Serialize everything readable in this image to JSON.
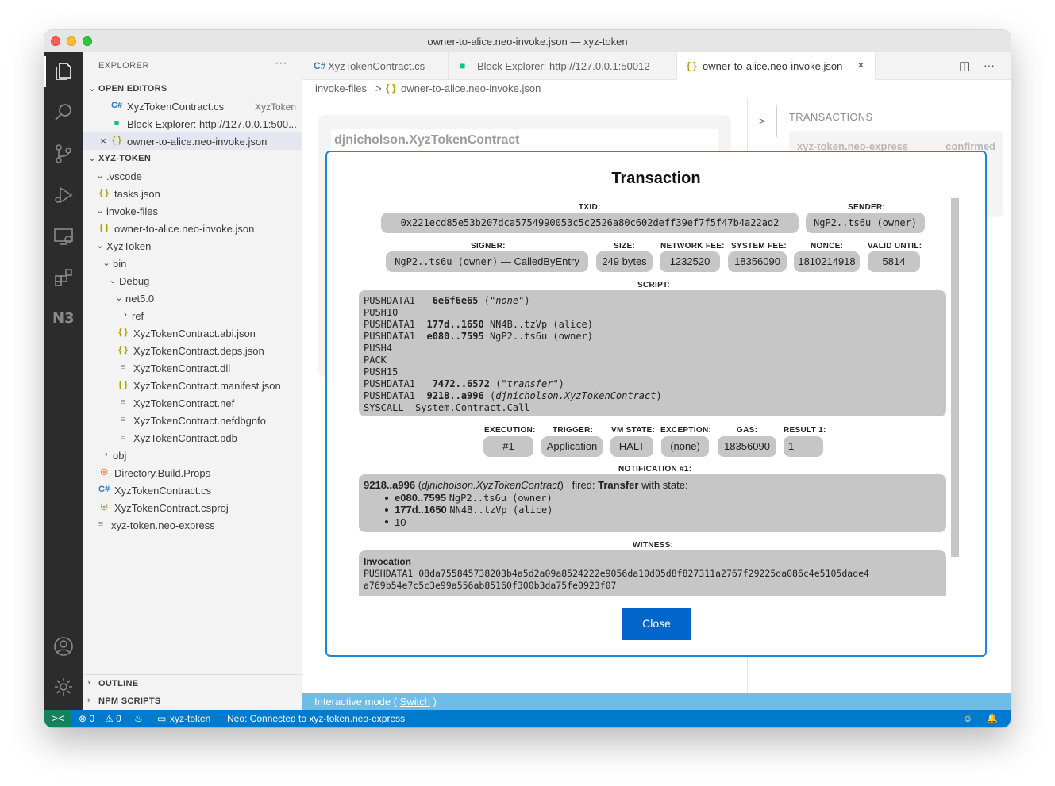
{
  "window": {
    "title": "owner-to-alice.neo-invoke.json — xyz-token"
  },
  "activity_bar": {
    "extension_label": "N3"
  },
  "sidebar": {
    "title": "EXPLORER",
    "more": "···",
    "open_editors_header": "OPEN EDITORS",
    "open_editors": [
      {
        "label": "XyzTokenContract.cs",
        "desc": "XyzToken",
        "icon": "C#"
      },
      {
        "label": "Block Explorer: http://127.0.0.1:500...",
        "desc": "",
        "icon": "neo"
      },
      {
        "label": "owner-to-alice.neo-invoke.json",
        "desc": "",
        "icon": "{ }"
      }
    ],
    "project_header": "XYZ-TOKEN",
    "tree": [
      {
        "label": ".vscode",
        "chev": "v"
      },
      {
        "label": "tasks.json",
        "icon": "{ }"
      },
      {
        "label": "invoke-files",
        "chev": "v"
      },
      {
        "label": "owner-to-alice.neo-invoke.json",
        "icon": "{ }"
      },
      {
        "label": "XyzToken",
        "chev": "v"
      },
      {
        "label": "bin",
        "chev": "v"
      },
      {
        "label": "Debug",
        "chev": "v"
      },
      {
        "label": "net5.0",
        "chev": "v"
      },
      {
        "label": "ref",
        "chev": ">"
      },
      {
        "label": "XyzTokenContract.abi.json",
        "icon": "{ }"
      },
      {
        "label": "XyzTokenContract.deps.json",
        "icon": "{ }"
      },
      {
        "label": "XyzTokenContract.dll",
        "icon": "≡"
      },
      {
        "label": "XyzTokenContract.manifest.json",
        "icon": "{ }"
      },
      {
        "label": "XyzTokenContract.nef",
        "icon": "≡"
      },
      {
        "label": "XyzTokenContract.nefdbgnfo",
        "icon": "≡"
      },
      {
        "label": "XyzTokenContract.pdb",
        "icon": "≡"
      },
      {
        "label": "obj",
        "chev": ">"
      },
      {
        "label": "Directory.Build.Props",
        "icon": "rss"
      },
      {
        "label": "XyzTokenContract.cs",
        "icon": "C#"
      },
      {
        "label": "XyzTokenContract.csproj",
        "icon": "rss"
      },
      {
        "label": "xyz-token.neo-express",
        "icon": "≡"
      }
    ],
    "outline": "OUTLINE",
    "npm_scripts": "NPM SCRIPTS"
  },
  "tabs": [
    {
      "label": "XyzTokenContract.cs",
      "icon": "C#"
    },
    {
      "label": "Block Explorer: http://127.0.0.1:50012",
      "icon": "neo"
    },
    {
      "label": "owner-to-alice.neo-invoke.json",
      "icon": "{ }",
      "close": "×"
    }
  ],
  "tab_actions": {
    "split": "◫",
    "more": "···"
  },
  "breadcrumb": {
    "folder": "invoke-files",
    "sep": ">",
    "file": "owner-to-alice.neo-invoke.json",
    "icon": "{ }"
  },
  "editor": {
    "contract": "djnicholson.XyzTokenContract",
    "panel_arrow": ">",
    "panel_title": "TRANSACTIONS",
    "panel_item": "xyz-token.neo-express",
    "panel_status": "confirmed"
  },
  "modal": {
    "title": "Transaction",
    "txid_label": "TXID:",
    "txid": "0x221ecd85e53b207dca5754990053c5c2526a80c602deff39ef7f5f47b4a22ad2",
    "sender_label": "SENDER:",
    "sender": "NgP2..ts6u (owner)",
    "signer_label": "SIGNER:",
    "signer_addr": "NgP2..ts6u (owner)",
    "signer_scope": "— CalledByEntry",
    "size_label": "SIZE:",
    "size": "249 bytes",
    "netfee_label": "NETWORK FEE:",
    "netfee": "1232520",
    "sysfee_label": "SYSTEM FEE:",
    "sysfee": "18356090",
    "nonce_label": "NONCE:",
    "nonce": "1810214918",
    "valid_label": "VALID UNTIL:",
    "valid": "5814",
    "script_label": "SCRIPT:",
    "script": [
      {
        "op": "PUSHDATA1  ",
        "hash": " 6e6f6e65",
        "rest": " (\"",
        "ital": "none",
        "end": "\")"
      },
      {
        "op": "PUSH10",
        "hash": "",
        "rest": "",
        "ital": "",
        "end": ""
      },
      {
        "op": "PUSHDATA1  ",
        "hash": "177d..1650",
        "rest": " NN4B..tzVp (alice)",
        "ital": "",
        "end": ""
      },
      {
        "op": "PUSHDATA1  ",
        "hash": "e080..7595",
        "rest": " NgP2..ts6u (owner)",
        "ital": "",
        "end": ""
      },
      {
        "op": "PUSH4",
        "hash": "",
        "rest": "",
        "ital": "",
        "end": ""
      },
      {
        "op": "PACK",
        "hash": "",
        "rest": "",
        "ital": "",
        "end": ""
      },
      {
        "op": "PUSH15",
        "hash": "",
        "rest": "",
        "ital": "",
        "end": ""
      },
      {
        "op": "PUSHDATA1  ",
        "hash": " 7472..6572",
        "rest": " (\"",
        "ital": "transfer",
        "end": "\")"
      },
      {
        "op": "PUSHDATA1  ",
        "hash": "9218..a996",
        "rest": " (",
        "ital": "djnicholson.XyzTokenContract",
        "end": ")"
      },
      {
        "op": "SYSCALL  System.Contract.Call",
        "hash": "",
        "rest": "",
        "ital": "",
        "end": ""
      }
    ],
    "execution_label": "EXECUTION:",
    "execution": "#1",
    "trigger_label": "TRIGGER:",
    "trigger": "Application",
    "vmstate_label": "VM STATE:",
    "vmstate": "HALT",
    "exception_label": "EXCEPTION:",
    "exception": "(none)",
    "gas_label": "GAS:",
    "gas": "18356090",
    "result_label": "RESULT 1:",
    "result": "1",
    "notification_label": "NOTIFICATION #1:",
    "notif_hash": "9218..a996",
    "notif_contract": "djnicholson.XyzTokenContract",
    "notif_fired": "fired:",
    "notif_event": "Transfer",
    "notif_state": "with state:",
    "notif_items": [
      {
        "hash": "e080..7595",
        "addr": "NgP2..ts6u (owner)"
      },
      {
        "hash": "177d..1650",
        "addr": "NN4B..tzVp (alice)"
      },
      {
        "hash": "10",
        "addr": ""
      }
    ],
    "witness_label": "WITNESS:",
    "witness_invocation": "Invocation",
    "witness_line1": "PUSHDATA1  08da755845738203b4a5d2a09a8524222e9056da10d05d8f827311a2767f29225da086c4e5105dade4",
    "witness_line2": "a769b54e7c5c3e99a556ab85160f300b3da75fe0923f07",
    "close": "Close"
  },
  "modebar": {
    "text": "Interactive mode (",
    "link": "Switch",
    "end": ")"
  },
  "statusbar": {
    "remote": "><",
    "errors": "⊗ 0",
    "warnings": "⚠ 0",
    "flame": "♨",
    "folder": "xyz-token",
    "neo": "Neo: Connected to xyz-token.neo-express",
    "feedback": "☺",
    "bell": "🔔"
  },
  "colors": {
    "activity_bg": "#2c2c2c",
    "sidebar_bg": "#f3f3f3",
    "status_blue": "#007acc",
    "modal_border": "#1a8ad6",
    "pill_gray": "#c6c6c6",
    "button_blue": "#0066cc"
  }
}
